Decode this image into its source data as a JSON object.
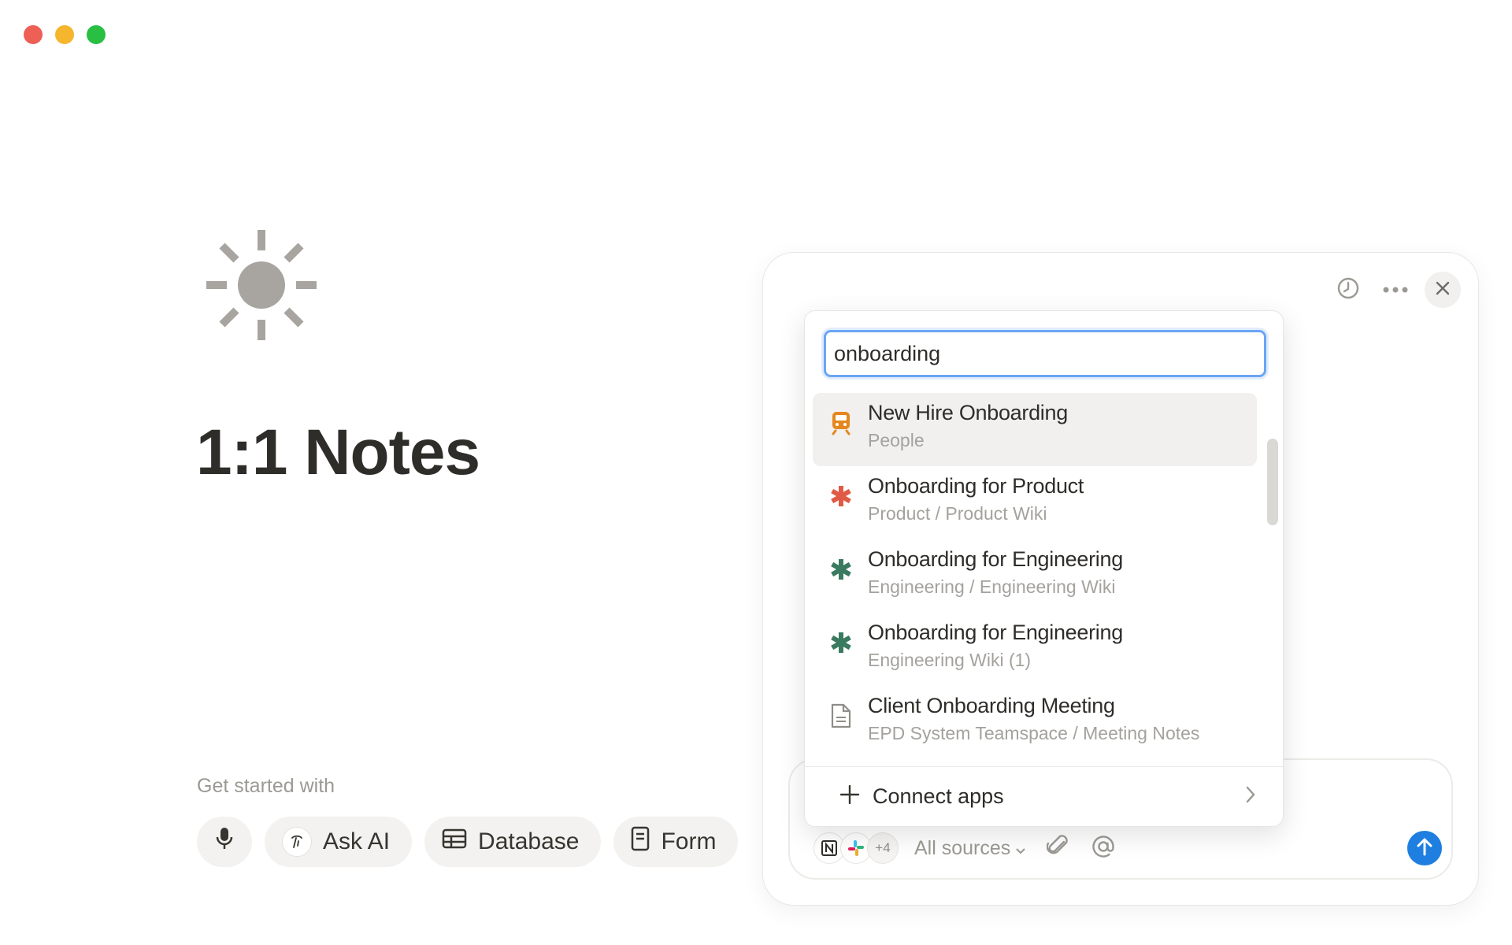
{
  "page": {
    "icon": "sun-icon",
    "title": "1:1 Notes",
    "get_started_label": "Get started with",
    "starters": [
      {
        "icon": "microphone-icon",
        "label": ""
      },
      {
        "icon": "ai-face-icon",
        "label": "Ask AI"
      },
      {
        "icon": "table-icon",
        "label": "Database"
      },
      {
        "icon": "form-icon",
        "label": "Form"
      }
    ]
  },
  "ai_panel": {
    "tools": [
      "history-icon",
      "more-icon",
      "close-icon"
    ],
    "composer": {
      "sources_more": "+4",
      "sources_label": "All sources"
    }
  },
  "mention_menu": {
    "query": "onboarding",
    "results": [
      {
        "icon": "train-icon",
        "title": "New Hire Onboarding",
        "path": "People",
        "active": true
      },
      {
        "icon": "asterisk-icon",
        "title": "Onboarding for Product",
        "path": "Product / Product Wiki",
        "active": false
      },
      {
        "icon": "asterisk-icon",
        "title": "Onboarding for Engineering",
        "path": "Engineering / Engineering Wiki",
        "active": false
      },
      {
        "icon": "asterisk-icon",
        "title": "Onboarding for Engineering",
        "path": "Engineering Wiki (1)",
        "active": false
      },
      {
        "icon": "document-icon",
        "title": "Client Onboarding Meeting",
        "path": "EPD System Teamspace / Meeting Notes",
        "active": false
      }
    ],
    "connect_label": "Connect apps"
  },
  "colors": {
    "accent_blue": "#1e7fe0",
    "focus_ring": "#6ba5f5",
    "product_asterisk": "#e05a45",
    "engineering_asterisk": "#3a7a5f",
    "train_orange": "#e5871e"
  }
}
